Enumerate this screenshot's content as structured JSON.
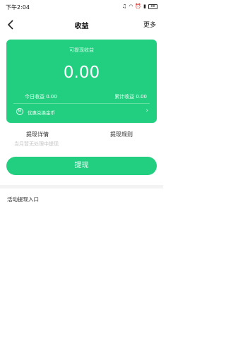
{
  "status_bar": {
    "time": "下午2:04",
    "icons": [
      "headset-icon",
      "wifi-icon",
      "alarm-icon",
      "signal-icon"
    ],
    "battery": "88"
  },
  "nav": {
    "title": "收益",
    "more": "更多"
  },
  "card": {
    "caption": "可提现收益",
    "amount": "0.00",
    "today_label": "今日收益 0.00",
    "total_label": "累计收益 0.00",
    "coin_icon_glyph": "M",
    "coin_text": "优惠兑换金币",
    "arrow": "›"
  },
  "tabs": {
    "detail": "提现详情",
    "rule": "提现规则"
  },
  "status_note": "当月暂无处理中提现",
  "withdraw_button": "提现",
  "entry": "活动提现入口",
  "colors": {
    "accent": "#22cf80"
  }
}
